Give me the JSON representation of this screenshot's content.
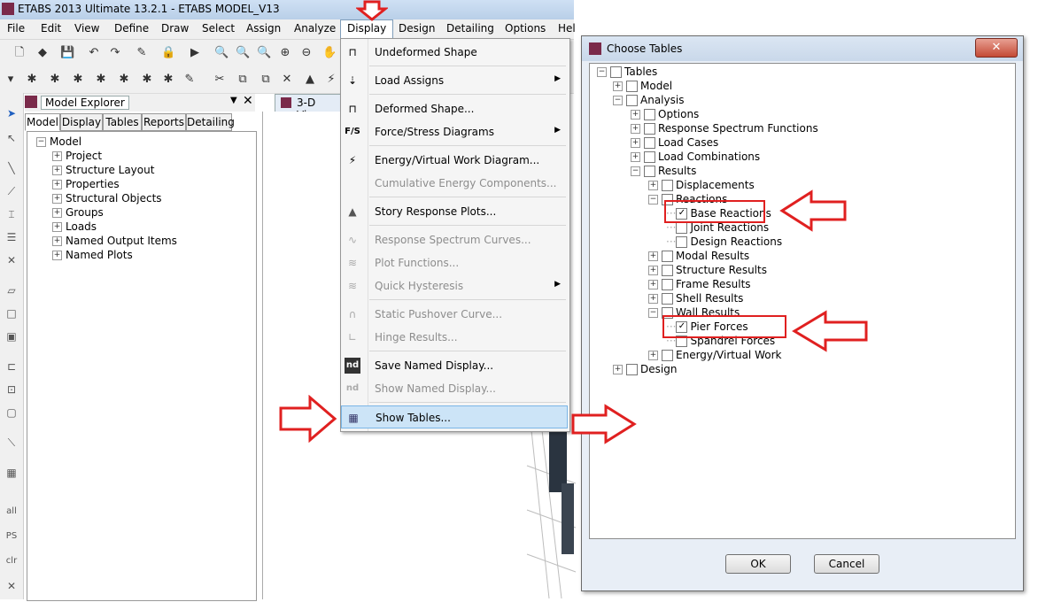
{
  "window": {
    "title": "ETABS 2013 Ultimate 13.2.1 - ETABS MODEL_V13"
  },
  "menubar": {
    "items": [
      "File",
      "Edit",
      "View",
      "Define",
      "Draw",
      "Select",
      "Assign",
      "Analyze",
      "Display",
      "Design",
      "Detailing",
      "Options",
      "Hel"
    ]
  },
  "explorer": {
    "title": "Model Explorer",
    "tabs": [
      "Model",
      "Display",
      "Tables",
      "Reports",
      "Detailing"
    ],
    "tree": {
      "root": "Model",
      "children": [
        "Project",
        "Structure Layout",
        "Properties",
        "Structural Objects",
        "Groups",
        "Loads",
        "Named Output Items",
        "Named Plots"
      ]
    }
  },
  "view": {
    "tab_label": "3-D View"
  },
  "vtoolbar": {
    "labels": [
      "all",
      "PS",
      "clr"
    ]
  },
  "display_menu": {
    "items": [
      {
        "label": "Undeformed Shape",
        "icon": "undeformed-icon",
        "glyph": "⊓"
      },
      {
        "label": "Load Assigns",
        "icon": "load-assigns-icon",
        "glyph": "⇣",
        "submenu": "▶"
      },
      {
        "label": "Deformed Shape...",
        "icon": "deformed-icon",
        "glyph": "⊓"
      },
      {
        "label": "Force/Stress Diagrams",
        "icon": "force-stress-icon",
        "glyph": "F/S",
        "submenu": "▶"
      },
      {
        "label": "Energy/Virtual Work Diagram...",
        "icon": "energy-icon",
        "glyph": "⚡"
      },
      {
        "label": "Cumulative Energy Components...",
        "icon": "",
        "glyph": ""
      },
      {
        "label": "Story Response Plots...",
        "icon": "story-response-icon",
        "glyph": "▲"
      },
      {
        "label": "Response Spectrum Curves...",
        "icon": "response-spectrum-icon",
        "glyph": "∿"
      },
      {
        "label": "Plot Functions...",
        "icon": "plot-functions-icon",
        "glyph": "≋"
      },
      {
        "label": "Quick Hysteresis",
        "icon": "hysteresis-icon",
        "glyph": "≋",
        "submenu": "▶"
      },
      {
        "label": "Static Pushover Curve...",
        "icon": "pushover-icon",
        "glyph": "∩"
      },
      {
        "label": "Hinge Results...",
        "icon": "hinge-icon",
        "glyph": "∟"
      },
      {
        "label": "Save Named Display...",
        "icon": "save-named-display-icon",
        "glyph": "nd"
      },
      {
        "label": "Show Named Display...",
        "icon": "show-named-display-icon",
        "glyph": "nd"
      },
      {
        "label": "Show Tables...",
        "icon": "tables-icon",
        "glyph": "▦"
      }
    ]
  },
  "dialog": {
    "title": "Choose Tables",
    "close_glyph": "✕",
    "tree": [
      {
        "label": "Tables",
        "checked": false
      },
      {
        "label": "Model",
        "checked": false
      },
      {
        "label": "Analysis",
        "checked": false
      },
      {
        "label": "Options",
        "checked": false
      },
      {
        "label": "Response Spectrum Functions",
        "checked": false
      },
      {
        "label": "Load Cases",
        "checked": false
      },
      {
        "label": "Load Combinations",
        "checked": false
      },
      {
        "label": "Results",
        "checked": false
      },
      {
        "label": "Displacements",
        "checked": false
      },
      {
        "label": "Reactions",
        "checked": false
      },
      {
        "label": "Base Reactions",
        "checked": true
      },
      {
        "label": "Joint Reactions",
        "checked": false
      },
      {
        "label": "Design Reactions",
        "checked": false
      },
      {
        "label": "Modal Results",
        "checked": false
      },
      {
        "label": "Structure Results",
        "checked": false
      },
      {
        "label": "Frame Results",
        "checked": false
      },
      {
        "label": "Shell Results",
        "checked": false
      },
      {
        "label": "Wall Results",
        "checked": false
      },
      {
        "label": "Pier Forces",
        "checked": true
      },
      {
        "label": "Spandrel Forces",
        "checked": false
      },
      {
        "label": "Energy/Virtual Work",
        "checked": false
      },
      {
        "label": "Design",
        "checked": false
      }
    ],
    "ok_label": "OK",
    "cancel_label": "Cancel",
    "check_glyph": "✓"
  },
  "colors": {
    "annotation_red": "#e02020",
    "highlight": "#cce4f7"
  }
}
